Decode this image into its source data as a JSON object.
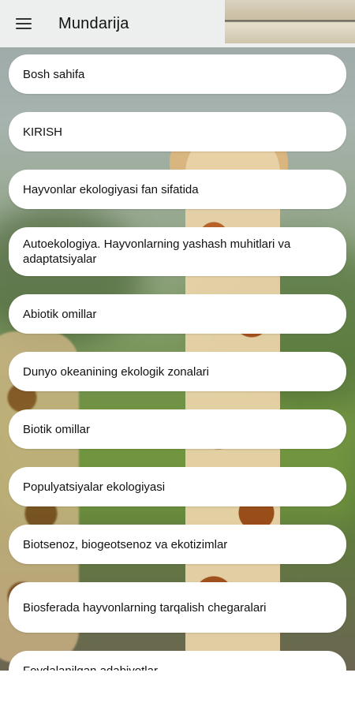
{
  "appbar": {
    "title": "Mundarija"
  },
  "menu": {
    "items": [
      {
        "label": "Bosh sahifa"
      },
      {
        "label": "KIRISH"
      },
      {
        "label": "Hayvonlar ekologiyasi fan sifatida"
      },
      {
        "label": "Autoekologiya. Hayvonlarning yashash muhitlari va adaptatsiyalar"
      },
      {
        "label": "Abiotik omillar"
      },
      {
        "label": "Dunyo okeanining ekologik zonalari"
      },
      {
        "label": "Biotik omillar"
      },
      {
        "label": "Populyatsiyalar ekologiyasi"
      },
      {
        "label": "Biotsenoz, biogeotsenoz va ekotizimlar"
      },
      {
        "label": "Biosferada hayvonlarning tarqalish chegaralari"
      },
      {
        "label": "Foydalanilgan adabiyotlar"
      }
    ]
  },
  "icons": {
    "menu": "hamburger-menu-icon"
  }
}
